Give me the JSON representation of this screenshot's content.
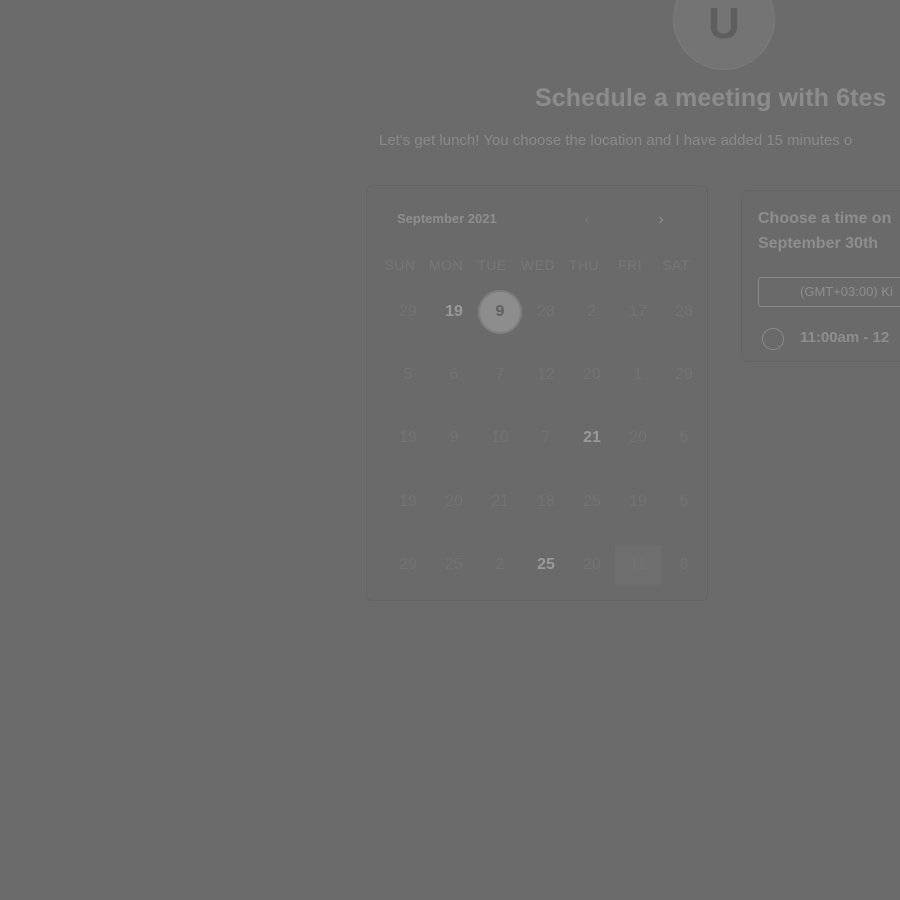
{
  "host": {
    "avatar_initial": "U"
  },
  "page": {
    "title": "Schedule a meeting with 6tes",
    "subtitle": "Let's get lunch! You choose the location and I have added 15 minutes o"
  },
  "calendar": {
    "month_label": "September 2021",
    "prev_icon": "chevron-left-icon",
    "next_icon": "chevron-right-icon",
    "prev_label": "‹",
    "next_label": "›",
    "weekdays": [
      "SUN",
      "MON",
      "TUE",
      "WED",
      "THU",
      "FRI",
      "SAT"
    ],
    "weeks": [
      [
        {
          "label": "29",
          "state": "muted"
        },
        {
          "label": "19",
          "state": "available"
        },
        {
          "label": "9",
          "state": "selected"
        },
        {
          "label": "28",
          "state": "muted"
        },
        {
          "label": "2",
          "state": "muted"
        },
        {
          "label": "17",
          "state": "muted"
        },
        {
          "label": "28",
          "state": "muted"
        }
      ],
      [
        {
          "label": "5",
          "state": "muted"
        },
        {
          "label": "6",
          "state": "muted"
        },
        {
          "label": "7",
          "state": "muted"
        },
        {
          "label": "12",
          "state": "muted"
        },
        {
          "label": "20",
          "state": "muted"
        },
        {
          "label": "1",
          "state": "muted"
        },
        {
          "label": "29",
          "state": "muted"
        }
      ],
      [
        {
          "label": "19",
          "state": "muted"
        },
        {
          "label": "9",
          "state": "muted"
        },
        {
          "label": "10",
          "state": "muted"
        },
        {
          "label": "7",
          "state": "muted"
        },
        {
          "label": "21",
          "state": "available"
        },
        {
          "label": "20",
          "state": "muted"
        },
        {
          "label": "5",
          "state": "muted"
        }
      ],
      [
        {
          "label": "19",
          "state": "muted"
        },
        {
          "label": "20",
          "state": "muted"
        },
        {
          "label": "21",
          "state": "muted"
        },
        {
          "label": "18",
          "state": "muted"
        },
        {
          "label": "25",
          "state": "muted"
        },
        {
          "label": "19",
          "state": "muted"
        },
        {
          "label": "5",
          "state": "muted"
        }
      ],
      [
        {
          "label": "29",
          "state": "muted"
        },
        {
          "label": "25",
          "state": "muted"
        },
        {
          "label": "2",
          "state": "muted"
        },
        {
          "label": "25",
          "state": "available"
        },
        {
          "label": "20",
          "state": "muted"
        },
        {
          "label": "11",
          "state": "marked"
        },
        {
          "label": "8",
          "state": "muted"
        }
      ]
    ]
  },
  "times": {
    "heading_line1": "Choose a time on",
    "heading_line2": "September 30th",
    "timezone": "(GMT+03:00) Ki",
    "slots": [
      {
        "label": "11:00am - 12"
      }
    ]
  },
  "colors": {
    "overlay": "#6b6b6b",
    "text_primary": "#8e8e8e",
    "text_muted": "#737373",
    "selected_ring": "#8d8d8d"
  }
}
